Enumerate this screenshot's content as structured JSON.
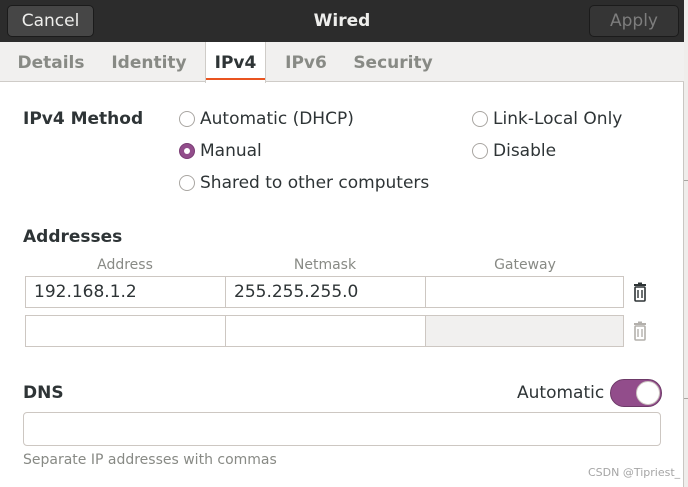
{
  "header": {
    "title": "Wired",
    "cancel_label": "Cancel",
    "apply_label": "Apply"
  },
  "tabs": [
    {
      "label": "Details"
    },
    {
      "label": "Identity"
    },
    {
      "label": "IPv4"
    },
    {
      "label": "IPv6"
    },
    {
      "label": "Security"
    }
  ],
  "active_tab": "IPv4",
  "ipv4_method": {
    "label": "IPv4 Method",
    "options": {
      "automatic_dhcp": "Automatic (DHCP)",
      "manual": "Manual",
      "shared": "Shared to other computers",
      "link_local": "Link-Local Only",
      "disable": "Disable"
    },
    "selected": "Manual"
  },
  "addresses": {
    "label": "Addresses",
    "columns": [
      "Address",
      "Netmask",
      "Gateway"
    ],
    "rows": [
      {
        "address": "192.168.1.2",
        "netmask": "255.255.255.0",
        "gateway": ""
      },
      {
        "address": "",
        "netmask": "",
        "gateway": ""
      }
    ]
  },
  "dns": {
    "label": "DNS",
    "automatic_label": "Automatic",
    "automatic_on": true,
    "value": "",
    "hint": "Separate IP addresses with commas"
  },
  "watermark": "CSDN @Tipriest_",
  "colors": {
    "accent": "#924d8b",
    "tab_underline": "#e95420",
    "header_bg": "#2c2c2c"
  },
  "icons": {
    "delete": "trash-icon"
  }
}
